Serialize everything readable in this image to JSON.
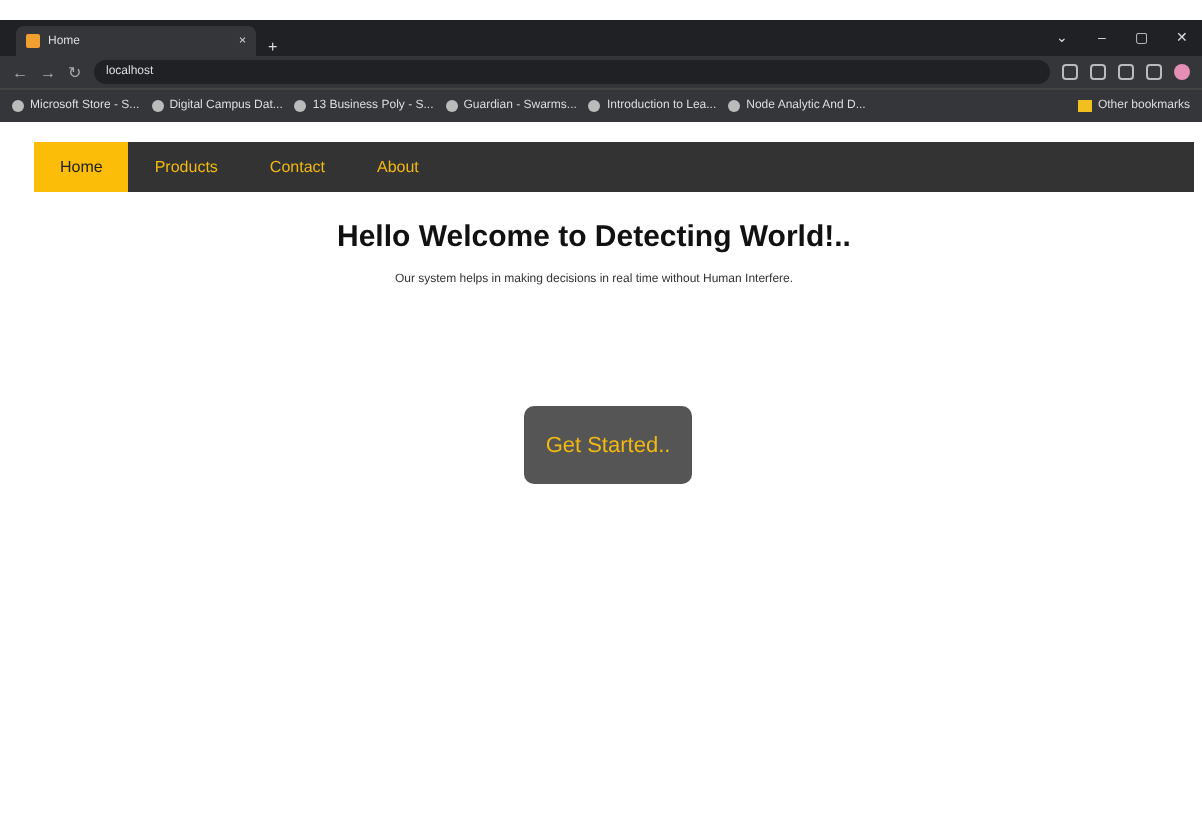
{
  "browser": {
    "tab": {
      "title": "Home",
      "close": "×"
    },
    "new_tab": "+",
    "window_controls": [
      "⌄",
      "–",
      "▢",
      "✕"
    ],
    "nav_buttons": [
      "←",
      "→",
      "↻"
    ],
    "address": "localhost",
    "bookmarks": [
      {
        "label": "Microsoft Store - S..."
      },
      {
        "label": "Digital Campus Dat..."
      },
      {
        "label": "13 Business Poly - S..."
      },
      {
        "label": "Guardian - Swarms..."
      },
      {
        "label": "Introduction to Lea..."
      },
      {
        "label": "Node Analytic And D..."
      }
    ],
    "other_bookmarks": "Other bookmarks"
  },
  "nav": [
    {
      "label": "Home",
      "selected": true
    },
    {
      "label": "Products",
      "selected": false
    },
    {
      "label": "Contact",
      "selected": false
    },
    {
      "label": "About",
      "selected": false
    }
  ],
  "heading": "Hello Welcome to Detecting World!..",
  "subtitle": "Our system helps in making decisions in real time without Human Interfere.",
  "cta": "Get Started.."
}
